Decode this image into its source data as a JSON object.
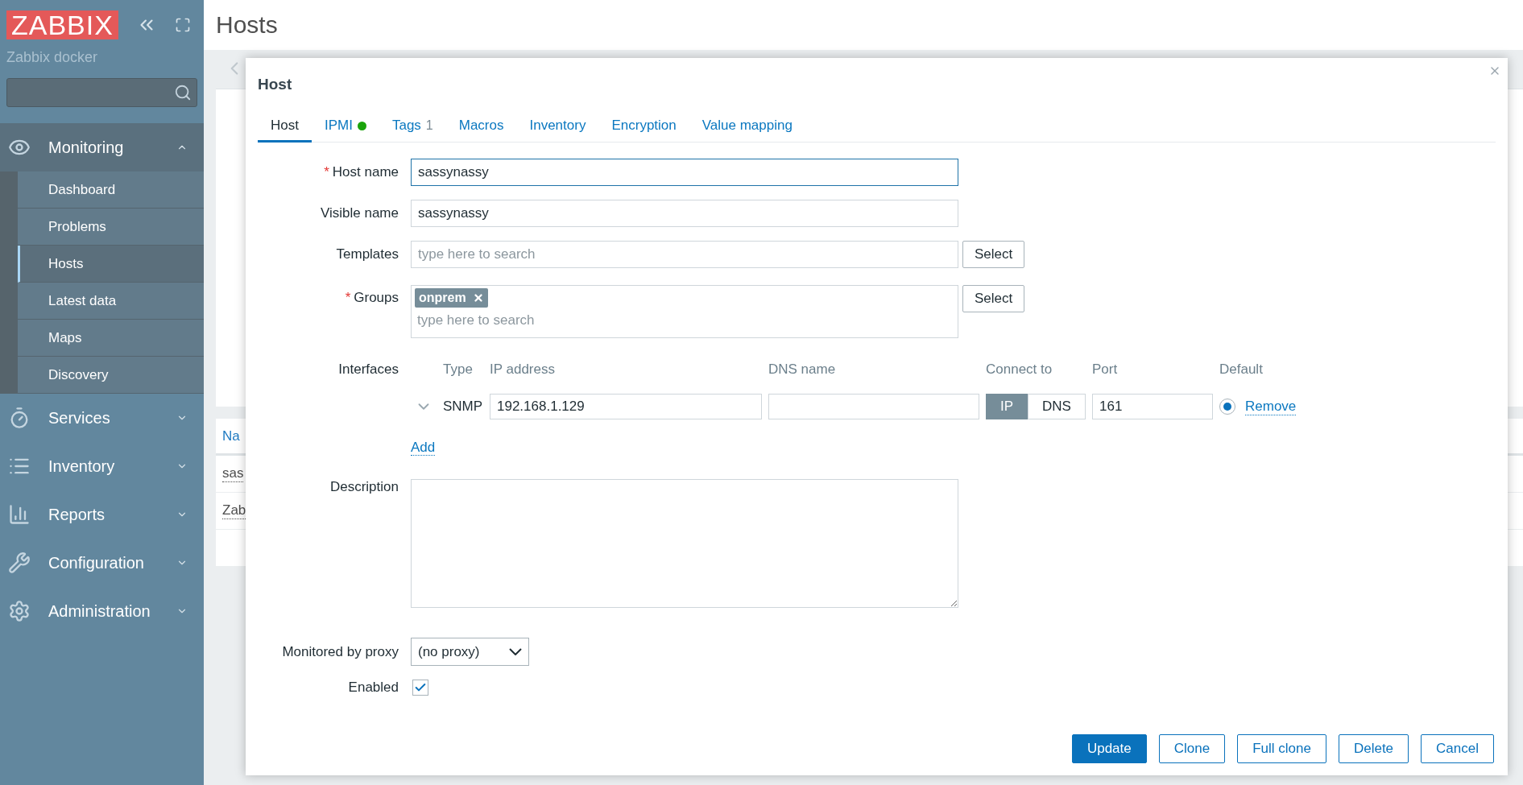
{
  "sidebar": {
    "logo": "ZABBIX",
    "server_name": "Zabbix docker",
    "menu": [
      {
        "label": "Monitoring",
        "expanded": true,
        "children": [
          {
            "label": "Dashboard",
            "selected": false
          },
          {
            "label": "Problems",
            "selected": false
          },
          {
            "label": "Hosts",
            "selected": true
          },
          {
            "label": "Latest data",
            "selected": false
          },
          {
            "label": "Maps",
            "selected": false
          },
          {
            "label": "Discovery",
            "selected": false
          }
        ]
      },
      {
        "label": "Services",
        "expanded": false
      },
      {
        "label": "Inventory",
        "expanded": false
      },
      {
        "label": "Reports",
        "expanded": false
      },
      {
        "label": "Configuration",
        "expanded": false
      },
      {
        "label": "Administration",
        "expanded": false
      }
    ]
  },
  "page_title": "Hosts",
  "background_table": {
    "header": "Na",
    "rows": [
      "sas",
      "Zab"
    ]
  },
  "dialog": {
    "title": "Host",
    "tabs": [
      {
        "label": "Host",
        "selected": true
      },
      {
        "label": "IPMI",
        "selected": false,
        "color": "#1aa30a"
      },
      {
        "label": "Tags",
        "selected": false,
        "count": "1"
      },
      {
        "label": "Macros",
        "selected": false
      },
      {
        "label": "Inventory",
        "selected": false
      },
      {
        "label": "Encryption",
        "selected": false
      },
      {
        "label": "Value mapping",
        "selected": false
      }
    ],
    "host_name": {
      "label": "Host name",
      "required_mark": "*",
      "value": "sassynassy",
      "focused": true
    },
    "visible_name": {
      "label": "Visible name",
      "value": "sassynassy"
    },
    "templates": {
      "label": "Templates",
      "placeholder": "type here to search",
      "button": "Select"
    },
    "groups": {
      "label": "Groups",
      "required_mark": "*",
      "chips": [
        "onprem"
      ],
      "placeholder": "type here to search",
      "button": "Select"
    },
    "interfaces": {
      "label": "Interfaces",
      "columns": [
        "Type",
        "IP address",
        "DNS name",
        "Connect to",
        "Port",
        "Default"
      ],
      "rows": [
        {
          "type": "SNMP",
          "ip": "192.168.1.129",
          "connect": [
            {
              "label": "IP",
              "selected": true
            },
            {
              "label": "DNS",
              "selected": false
            }
          ],
          "port": "161",
          "default": true,
          "remove": "Remove"
        }
      ],
      "add": "Add"
    },
    "description": {
      "label": "Description"
    },
    "proxy": {
      "label": "Monitored by proxy",
      "value": "(no proxy)"
    },
    "enabled": {
      "label": "Enabled",
      "checked": true
    },
    "buttons": [
      {
        "label": "Update",
        "primary": true
      },
      {
        "label": "Clone",
        "primary": false
      },
      {
        "label": "Full clone",
        "primary": false
      },
      {
        "label": "Delete",
        "primary": false
      },
      {
        "label": "Cancel",
        "primary": false
      }
    ]
  }
}
